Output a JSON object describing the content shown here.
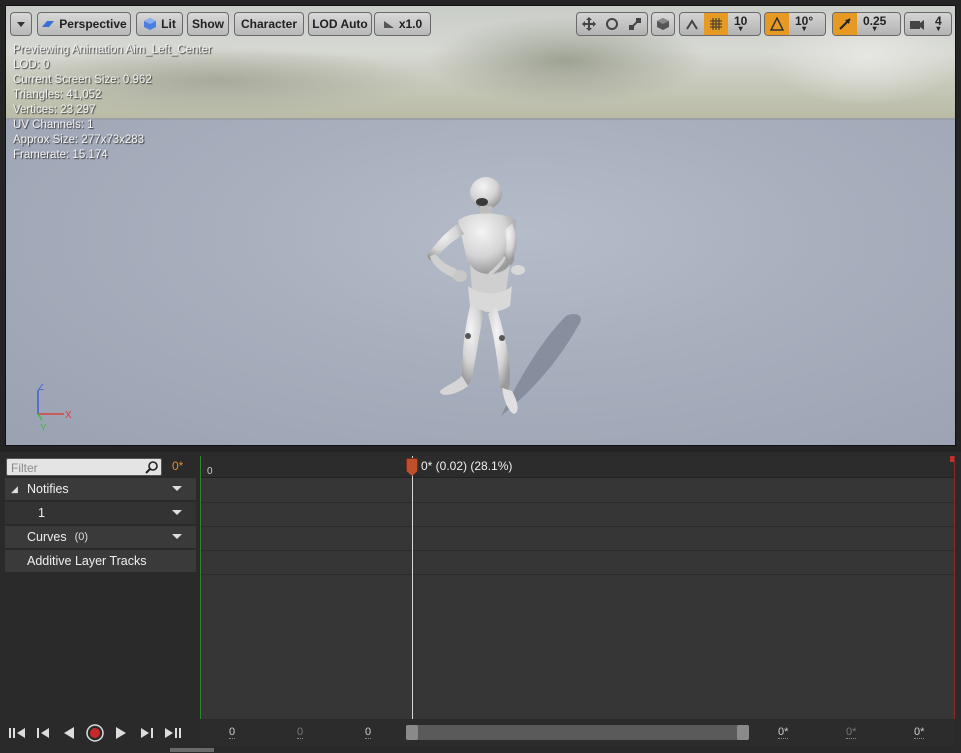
{
  "toolbar": {
    "menu_icon": "chevron-down-icon",
    "perspective_label": "Perspective",
    "lit_label": "Lit",
    "show_label": "Show",
    "character_label": "Character",
    "lod_label": "LOD Auto",
    "speed_label": "x1.0",
    "grid_snap_value": "10",
    "rotation_snap_value": "10°",
    "scale_snap_value": "0.25",
    "camera_speed_value": "4",
    "accent_color": "#e69a23"
  },
  "stats": {
    "previewing": "Previewing Animation Aim_Left_Center",
    "lod": "LOD: 0",
    "screen_size": "Current Screen Size: 0.962",
    "triangles": "Triangles: 41,052",
    "vertices": "Vertices: 23,297",
    "uv_channels": "UV Channels: 1",
    "approx_size": "Approx Size: 277x73x283",
    "framerate": "Framerate: 15.174"
  },
  "axis": {
    "z": "Z",
    "x": "X",
    "y": "Y"
  },
  "panel": {
    "filter_placeholder": "Filter",
    "frame_label": "0*",
    "tracks": [
      {
        "label": "Notifies"
      },
      {
        "label": "1"
      },
      {
        "label": "Curves",
        "count": "(0)"
      },
      {
        "label": "Additive Layer Tracks"
      }
    ],
    "ruler_zero": "0",
    "playhead_label": "0* (0.02) (28.1%)",
    "scrub_values": [
      "0",
      "0",
      "0",
      "0*",
      "0*",
      "0*"
    ]
  }
}
